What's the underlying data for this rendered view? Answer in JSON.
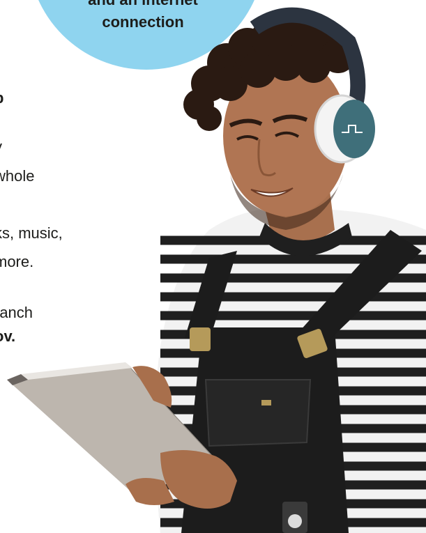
{
  "bubble": {
    "line1": "and an internet",
    "line2": "connection",
    "color": "#8fd4ef"
  },
  "body": {
    "lines": [
      "p",
      "y",
      "whole",
      "ks, music,",
      " more.",
      "ranch",
      "ov."
    ]
  },
  "photo": {
    "subject": "young man with curly hair wearing headphones, striped shirt and black overalls, holding a tablet"
  }
}
